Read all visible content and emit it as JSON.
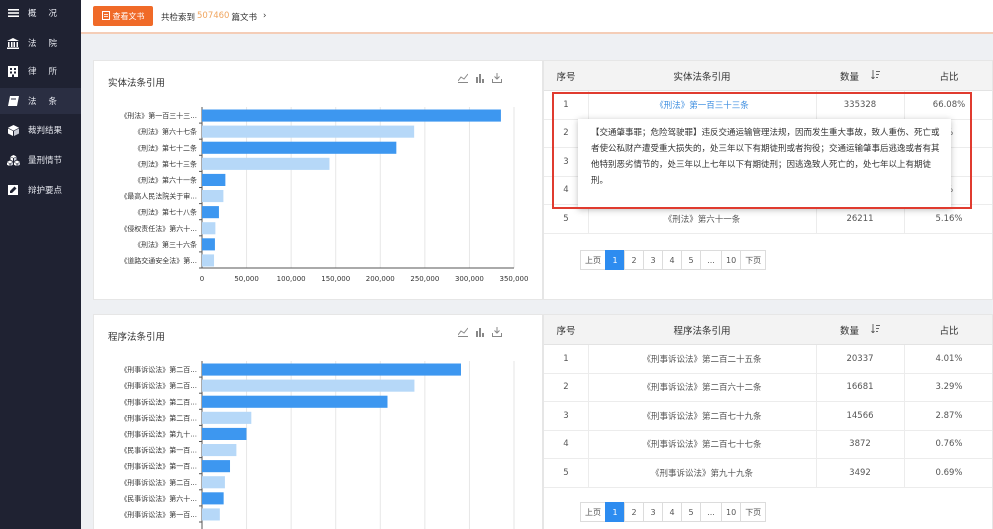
{
  "sidebar": {
    "items": [
      {
        "label": "概况",
        "icon": "menu-list-icon"
      },
      {
        "label": "法院",
        "icon": "court-building-icon"
      },
      {
        "label": "律所",
        "icon": "law-firm-building-icon"
      },
      {
        "label": "法条",
        "icon": "book-icon"
      },
      {
        "label": "裁判结果",
        "icon": "cube-icon"
      },
      {
        "label": "量刑情节",
        "icon": "cubes-icon"
      },
      {
        "label": "辩护要点",
        "icon": "edit-icon"
      }
    ],
    "active_index": 3
  },
  "topbar": {
    "view_button": "查看文书",
    "found_prefix": "共检索到",
    "found_count": "507460",
    "found_suffix": "篇文书",
    "chevron": "›"
  },
  "substantive": {
    "title": "实体法条引用",
    "table_headers": {
      "index": "序号",
      "article": "实体法条引用",
      "count": "数量",
      "ratio": "占比"
    },
    "rows": [
      {
        "index": "1",
        "article": "《刑法》第一百三十三条",
        "count": "335328",
        "ratio": "66.08%"
      },
      {
        "index": "2",
        "article": "",
        "count": "",
        "ratio": "%"
      },
      {
        "index": "3",
        "article": "",
        "count": "",
        "ratio": ""
      },
      {
        "index": "4",
        "article": "",
        "count": "",
        "ratio": "%"
      },
      {
        "index": "5",
        "article": "《刑法》第六十一条",
        "count": "26211",
        "ratio": "5.16%"
      }
    ],
    "pager": [
      "上页",
      "1",
      "2",
      "3",
      "4",
      "5",
      "...",
      "10",
      "下页"
    ],
    "tooltip": "【交通肇事罪；危险驾驶罪】违反交通运输管理法规，因而发生重大事故，致人重伤、死亡或者使公私财产遭受重大损失的，处三年以下有期徒刑或者拘役；交通运输肇事后逃逸或者有其他特别恶劣情节的，处三年以上七年以下有期徒刑；因逃逸致人死亡的，处七年以上有期徒刑。"
  },
  "procedural": {
    "title": "程序法条引用",
    "table_headers": {
      "index": "序号",
      "article": "程序法条引用",
      "count": "数量",
      "ratio": "占比"
    },
    "rows": [
      {
        "index": "1",
        "article": "《刑事诉讼法》第二百二十五条",
        "count": "20337",
        "ratio": "4.01%"
      },
      {
        "index": "2",
        "article": "《刑事诉讼法》第二百六十二条",
        "count": "16681",
        "ratio": "3.29%"
      },
      {
        "index": "3",
        "article": "《刑事诉讼法》第二百七十九条",
        "count": "14566",
        "ratio": "2.87%"
      },
      {
        "index": "4",
        "article": "《刑事诉讼法》第二百七十七条",
        "count": "3872",
        "ratio": "0.76%"
      },
      {
        "index": "5",
        "article": "《刑事诉讼法》第九十九条",
        "count": "3492",
        "ratio": "0.69%"
      }
    ],
    "pager": [
      "上页",
      "1",
      "2",
      "3",
      "4",
      "5",
      "...",
      "10",
      "下页"
    ]
  },
  "colors": {
    "bar_dark": "#3d97f0",
    "bar_light": "#b6d8f8",
    "accent": "#f06a28",
    "active_page": "#2d8cf0"
  },
  "chart_data": [
    {
      "type": "bar",
      "orientation": "horizontal",
      "title": "实体法条引用",
      "categories": [
        "《刑法》第一百三十三...",
        "《刑法》第六十七条",
        "《刑法》第七十二条",
        "《刑法》第七十三条",
        "《刑法》第六十一条",
        "《最高人民法院关于审...",
        "《刑法》第七十八条",
        "《侵权责任法》第六十...",
        "《刑法》第三十六条",
        "《道路交通安全法》第..."
      ],
      "values": [
        335328,
        238000,
        218000,
        143000,
        26211,
        24000,
        19000,
        15000,
        14500,
        13500
      ],
      "xlim": [
        0,
        350000
      ],
      "xticks": [
        "0",
        "50,000",
        "100,000",
        "150,000",
        "200,000",
        "250,000",
        "300,000",
        "350,000"
      ],
      "grid": true
    },
    {
      "type": "bar",
      "orientation": "horizontal",
      "title": "程序法条引用",
      "categories": [
        "《刑事诉讼法》第二百...",
        "《刑事诉讼法》第二百...",
        "《刑事诉讼法》第二百...",
        "《刑事诉讼法》第二百...",
        "《刑事诉讼法》第九十...",
        "《民事诉讼法》第一百...",
        "《刑事诉讼法》第一百...",
        "《刑事诉讼法》第二百...",
        "《民事诉讼法》第六十...",
        "《刑事诉讼法》第一百..."
      ],
      "values": [
        20337,
        16681,
        14566,
        3872,
        3492,
        2700,
        2200,
        1800,
        1700,
        1400
      ],
      "grid": true
    }
  ]
}
